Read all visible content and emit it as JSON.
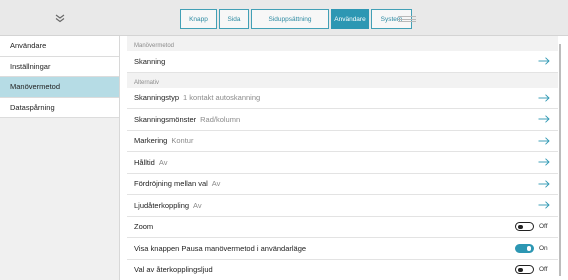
{
  "header": {
    "collapse_icon": "double-chevron-down-icon",
    "tabs": [
      {
        "label": "Knapp",
        "active": false
      },
      {
        "label": "Sida",
        "active": false
      },
      {
        "label": "Siduppsättning",
        "active": false
      },
      {
        "label": "Användare",
        "active": true
      },
      {
        "label": "System",
        "active": false
      }
    ],
    "handle_icon": "drag-handle-icon"
  },
  "sidebar": {
    "items": [
      {
        "label": "Användare",
        "active": false
      },
      {
        "label": "Inställningar",
        "active": false
      },
      {
        "label": "Manövermetod",
        "active": true
      },
      {
        "label": "Dataspårning",
        "active": false
      }
    ]
  },
  "main": {
    "sections": [
      {
        "header": "Manövermetod",
        "rows": [
          {
            "label": "Skanning",
            "value": "",
            "control": "arrow"
          }
        ]
      },
      {
        "header": "Alternativ",
        "rows": [
          {
            "label": "Skanningstyp",
            "value": "1 kontakt autoskanning",
            "control": "arrow"
          },
          {
            "label": "Skanningsmönster",
            "value": "Rad/kolumn",
            "control": "arrow"
          },
          {
            "label": "Markering",
            "value": "Kontur",
            "control": "arrow"
          },
          {
            "label": "Hålltid",
            "value": "Av",
            "control": "arrow"
          },
          {
            "label": "Fördröjning mellan val",
            "value": "Av",
            "control": "arrow"
          },
          {
            "label": "Ljudåterkoppling",
            "value": "Av",
            "control": "arrow"
          },
          {
            "label": "Zoom",
            "value": "",
            "control": "toggle",
            "state": "Off"
          },
          {
            "label": "Visa knappen Pausa manövermetod i användarläge",
            "value": "",
            "control": "toggle",
            "state": "On"
          },
          {
            "label": "Val av återkopplingsljud",
            "value": "",
            "control": "toggle",
            "state": "Off"
          }
        ]
      }
    ]
  },
  "colors": {
    "accent": "#2d97b3",
    "tab_border": "#42a0b6",
    "sidebar_active": "#b6dce5",
    "topbar_bg": "#e9e9e9",
    "section_header_text": "#8a8a8a"
  }
}
